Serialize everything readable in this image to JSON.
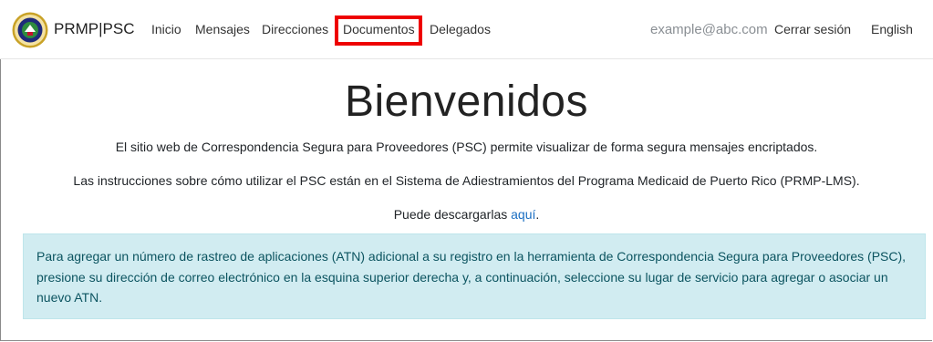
{
  "header": {
    "brand": "PRMP|PSC",
    "nav": [
      {
        "label": "Inicio"
      },
      {
        "label": "Mensajes"
      },
      {
        "label": "Direcciones"
      },
      {
        "label": "Documentos"
      },
      {
        "label": "Delegados"
      }
    ],
    "email": "example@abc.com",
    "logout_label": "Cerrar sesión",
    "language_label": "English"
  },
  "main": {
    "title": "Bienvenidos",
    "intro": "El sitio web de Correspondencia Segura para Proveedores (PSC) permite visualizar de forma segura mensajes encriptados.",
    "instructions": "Las instrucciones sobre cómo utilizar el PSC están en el Sistema de Adiestramientos del Programa Medicaid de Puerto Rico (PRMP-LMS).",
    "download_prefix": "Puede descargarlas ",
    "download_link": "aquí",
    "download_suffix": ".",
    "info_text": "Para agregar un número de rastreo de aplicaciones (ATN) adicional a su registro en la herramienta de Correspondencia Segura para Proveedores (PSC), presione su dirección de correo electrónico en la esquina superior derecha y, a continuación, seleccione su lugar de servicio para agregar o asociar un nuevo ATN."
  },
  "colors": {
    "highlight": "#ee0000",
    "link": "#1a6ec2",
    "info_bg": "#d1ecf1",
    "info_text": "#0c5460"
  }
}
